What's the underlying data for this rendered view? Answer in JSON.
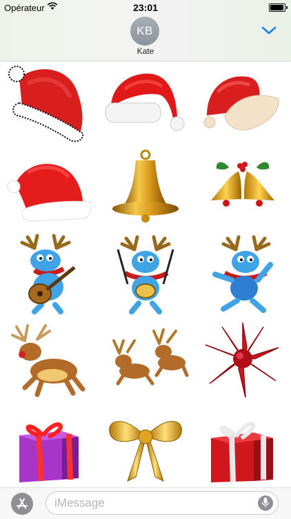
{
  "status_bar": {
    "carrier": "Opérateur",
    "time": "23:01",
    "wifi_icon": "wifi-icon",
    "battery_icon": "battery-icon",
    "battery_level": 1.0
  },
  "header": {
    "avatar_initials": "KB",
    "contact_name": "Kate",
    "collapse_icon": "chevron-down-icon",
    "accent_color": "#1a7cf5"
  },
  "stickers": [
    {
      "label": "santa-hat-fluffy"
    },
    {
      "label": "santa-hat-white-band"
    },
    {
      "label": "santa-hat-cream-band"
    },
    {
      "label": "santa-hat-side"
    },
    {
      "label": "golden-bell"
    },
    {
      "label": "jingle-bells-holly"
    },
    {
      "label": "reindeer-guitar"
    },
    {
      "label": "reindeer-drummer"
    },
    {
      "label": "reindeer-dancing"
    },
    {
      "label": "reindeer-leaping"
    },
    {
      "label": "two-reindeer-running"
    },
    {
      "label": "red-gift-bow"
    },
    {
      "label": "purple-gift-box"
    },
    {
      "label": "gold-ribbon-bow"
    },
    {
      "label": "red-gift-box"
    }
  ],
  "input_bar": {
    "apps_icon": "app-store-icon",
    "placeholder": "iMessage",
    "value": "",
    "mic_icon": "microphone-icon"
  }
}
